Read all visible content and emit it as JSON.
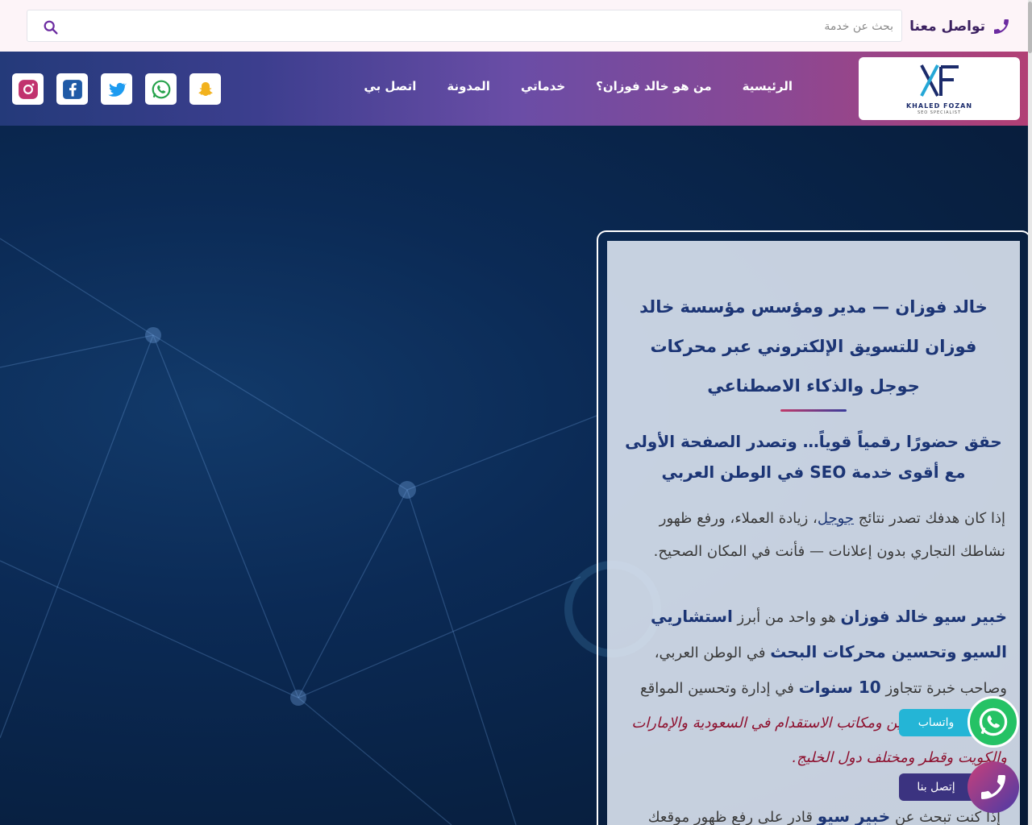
{
  "topbar": {
    "contact_label": "تواصل معنا",
    "search_placeholder": "بحث عن خدمة"
  },
  "logo": {
    "name": "KHALED FOZAN",
    "tagline": "SEO SPECIALIST"
  },
  "nav": {
    "items": [
      {
        "label": "الرئيسية"
      },
      {
        "label": "من هو خالد فوزان؟"
      },
      {
        "label": "خدماتي"
      },
      {
        "label": "المدونة"
      },
      {
        "label": "اتصل بي"
      }
    ]
  },
  "socials": [
    "snapchat-icon",
    "whatsapp-icon",
    "twitter-icon",
    "facebook-icon",
    "instagram-icon"
  ],
  "card": {
    "title": "خالد فوزان — مدير ومؤسس مؤسسة خالد فوزان للتسويق الإلكتروني عبر محركات جوجل والذكاء الاصطناعي",
    "subtitle": "حقق حضورًا رقمياً قوياً… وتصدر الصفحة الأولى مع أقوى خدمة SEO في الوطن العربي",
    "p1_a": "إذا كان هدفك تصدر نتائج ",
    "p1_link": "جوجل",
    "p1_b": "، زيادة العملاء، ورفع ظهور نشاطك التجاري بدون إعلانات — فأنت في المكان الصحيح.",
    "p2_s1": "خبير سيو خالد فوزان",
    "p2_t1": " هو واحد من أبرز ",
    "p2_s2": "استشاريي السيو وتحسين محركات البحث",
    "p2_t2": " في الوطن العربي، وصاحب خبرة تتجاوز ",
    "p2_s3": "10 سنوات",
    "p2_t3": " في إدارة وتحسين المواقع ",
    "p2_accent": "للشركات والمحامين ومكاتب الاستقدام في السعودية والإمارات والكويت وقطر ومختلف دول الخليج.",
    "p3_a": "إذا كنت تبحث عن ",
    "p3_s": "خبير سيو",
    "p3_b": " قادر على رفع ظهور موقعك"
  },
  "floating": {
    "whatsapp_label": "واتساب",
    "call_label": "إتصل بنا"
  },
  "colors": {
    "primary": "#1c3575",
    "accent": "#8e1230",
    "whatsapp": "#25c265"
  }
}
